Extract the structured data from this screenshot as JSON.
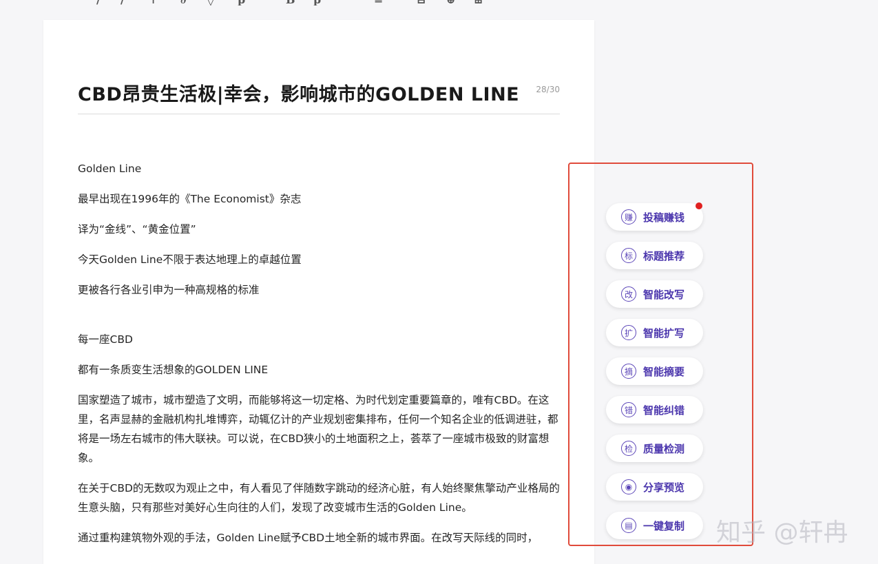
{
  "editor": {
    "title": "CBD昂贵生活极|幸会，影响城市的GOLDEN LINE",
    "title_count": "28/30",
    "paragraphs": [
      "Golden Line",
      "最早出现在1996年的《The Economist》杂志",
      "译为“金线”、“黄金位置”",
      "今天Golden Line不限于表达地理上的卓越位置",
      "更被各行各业引申为一种高规格的标准",
      "每一座CBD",
      "都有一条质变生活想象的GOLDEN LINE",
      "国家塑造了城市，城市塑造了文明，而能够将这一切定格、为时代划定重要篇章的，唯有CBD。在这里，名声显赫的金融机构扎堆博弈，动辄亿计的产业规划密集排布，任何一个知名企业的低调进驻，都将是一场左右城市的伟大联袂。可以说，在CBD狭小的土地面积之上，荟萃了一座城市极致的财富想象。",
      "在关于CBD的无数叹为观止之中，有人看见了伴随数字跳动的经济心脏，有人始终聚焦擎动产业格局的生意头脑，只有那些对美好心生向往的人们，发现了改变城市生活的Golden Line。",
      "通过重构建筑物外观的手法，Golden Line赋予CBD土地全新的城市界面。在改写天际线的同时，"
    ]
  },
  "tools": [
    {
      "icon": "赚",
      "label": "投稿赚钱"
    },
    {
      "icon": "标",
      "label": "标题推荐"
    },
    {
      "icon": "改",
      "label": "智能改写"
    },
    {
      "icon": "扩",
      "label": "智能扩写"
    },
    {
      "icon": "摘",
      "label": "智能摘要"
    },
    {
      "icon": "错",
      "label": "智能纠错"
    },
    {
      "icon": "检",
      "label": "质量检测"
    },
    {
      "icon": "◉",
      "label": "分享预览"
    },
    {
      "icon": "▤",
      "label": "一键复制"
    }
  ],
  "watermark": "知乎 @轩冉",
  "toolbar_glyphs": [
    "/",
    "/",
    "⊢",
    "∂",
    "◊",
    "p",
    "B",
    "p",
    "≡",
    "⊟",
    "⊕",
    "⊞"
  ],
  "colors": {
    "accent": "#4b36ad",
    "highlight_border": "#e04a3a",
    "badge": "#e02020"
  }
}
